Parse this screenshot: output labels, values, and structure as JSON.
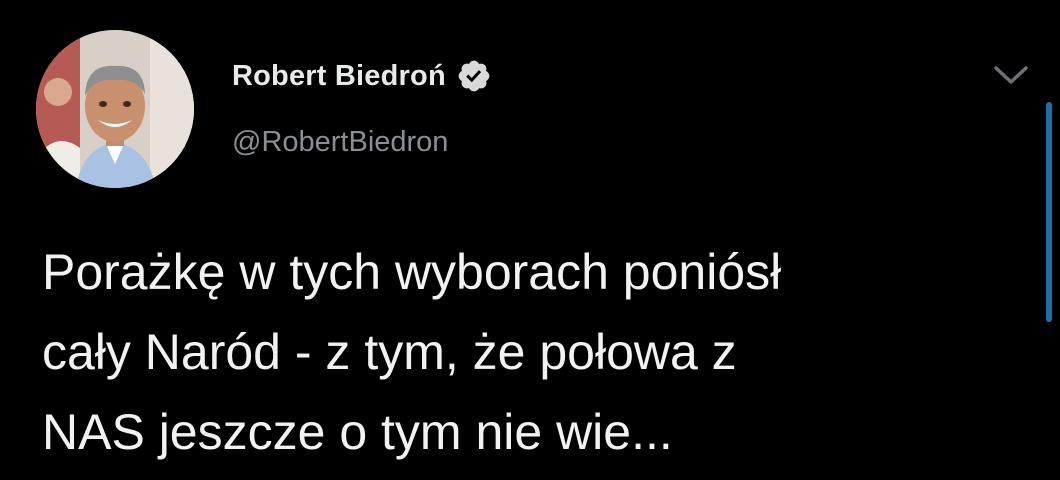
{
  "tweet": {
    "author": {
      "display_name": "Robert Biedroń",
      "handle": "@RobertBiedron",
      "verified": true,
      "avatar_icon": "profile-photo"
    },
    "text_lines": [
      "Porażkę w tych wyborach poniósł",
      "cały Naród - z tym, że połowa z",
      "NAS jeszcze o tym nie wie..."
    ],
    "menu_icon": "chevron-down-icon"
  },
  "colors": {
    "background": "#000000",
    "text_primary": "#f2f2f2",
    "text_secondary": "#8b8f94",
    "verified_badge": "#d9d9d9",
    "scroll_indicator": "#1d6fa5"
  }
}
